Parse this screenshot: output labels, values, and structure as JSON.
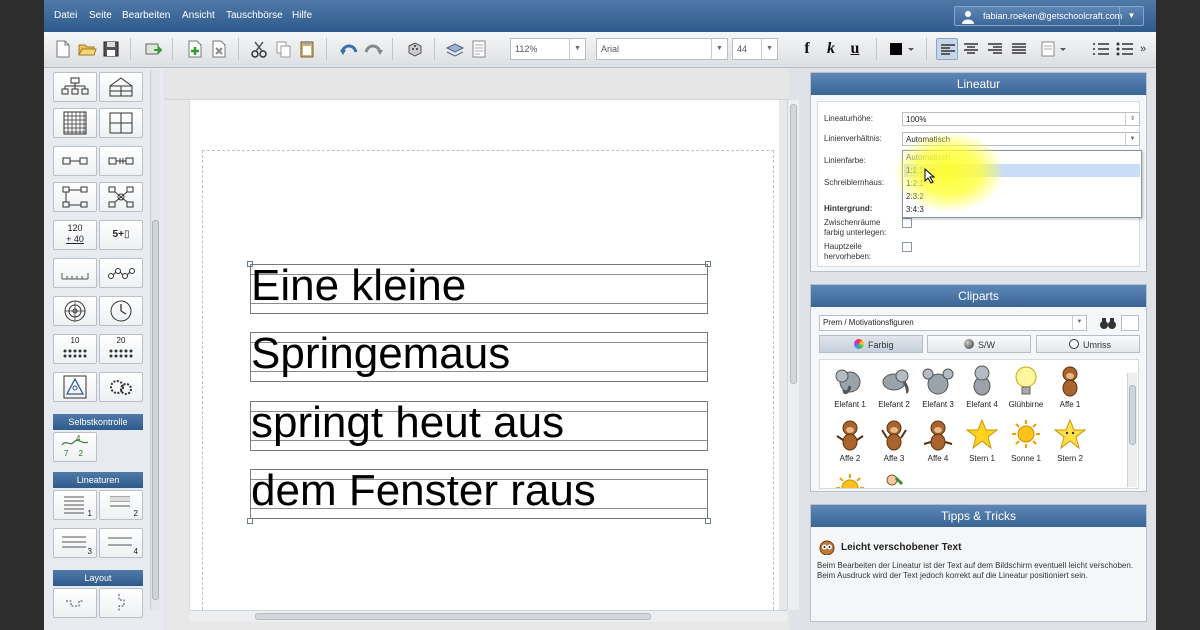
{
  "menubar": {
    "items": [
      "Datei",
      "Seite",
      "Bearbeiten",
      "Ansicht",
      "Tauschbörse",
      "Hilfe"
    ],
    "user_email": "fabian.roeken@getschoolcraft.com"
  },
  "toolbar": {
    "zoom": "112%",
    "font": "Arial",
    "font_size": "44",
    "bold_label": "f",
    "italic_label": "k",
    "underline_label": "u",
    "more_label": "»"
  },
  "toolbox": {
    "arith_top": "120",
    "arith_bottom": "+ 40",
    "sum_label": "5+▯",
    "dots_10": "10",
    "dots_20": "20",
    "fraction_top": "4",
    "fraction_bottom": "7 2",
    "selbstkontrolle": "Selbstkontrolle",
    "lineaturen": "Lineaturen",
    "lin_1": "1",
    "lin_2": "2",
    "lin_3": "3",
    "lin_4": "4",
    "layout": "Layout"
  },
  "document": {
    "lines": [
      "Eine kleine",
      "Springemaus",
      "springt heut aus",
      "dem Fenster raus"
    ]
  },
  "lineatur_panel": {
    "title": "Lineatur",
    "hoehe_label": "Lineaturhöhe:",
    "hoehe_value": "100%",
    "verhaeltnis_label": "Linienverhältnis:",
    "verhaeltnis_value": "Automatisch",
    "farbe_label": "Linienfarbe:",
    "schreiblernhaus_label": "Schreiblernhaus:",
    "hintergrund_label": "Hintergrund:",
    "zwischenraeume_label_1": "Zwischenräume",
    "zwischenraeume_label_2": "farbig unterlegen:",
    "hauptzeile_label_1": "Hauptzeile",
    "hauptzeile_label_2": "hervorheben:",
    "options": [
      "Automatisch",
      "1:1:1",
      "1:2:1",
      "2:3:2",
      "3:4:3"
    ],
    "highlighted_option": "1:1:1"
  },
  "cliparts_panel": {
    "title": "Cliparts",
    "category": "Prem / Motivationsfiguren",
    "filters": [
      "Farbig",
      "S/W",
      "Umriss"
    ],
    "items_row1": [
      "Elefant 1",
      "Elefant 2",
      "Elefant 3",
      "Elefant 4",
      "Glühbirne",
      "Affe 1"
    ],
    "items_row2": [
      "Affe 2",
      "Affe 3",
      "Affe 4",
      "Stern 1",
      "Sonne 1",
      "Stern 2"
    ]
  },
  "tipps_panel": {
    "title": "Tipps & Tricks",
    "heading": "Leicht verschobener Text",
    "body": "Beim Bearbeiten der Lineatur ist der Text auf dem Bildschirm eventuell leicht verschoben. Beim Ausdruck wird der Text jedoch korrekt auf die Lineatur positioniert sein."
  },
  "colors": {
    "accent": "#3a6596",
    "menubar": "#3f6a9a",
    "highlight": "#ffff33",
    "selected_option": "#c9ddf6"
  }
}
